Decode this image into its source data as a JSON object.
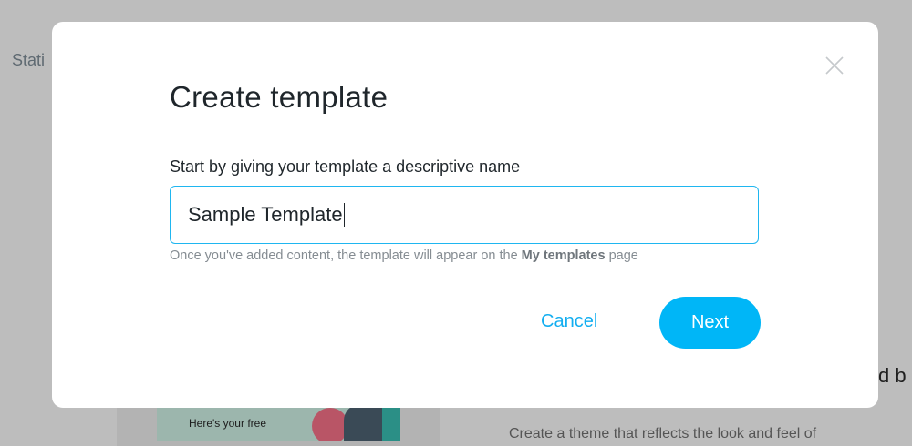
{
  "background": {
    "status_text": "Stati",
    "promo_text": "Here's your free",
    "heading_fragment": "d b",
    "body_fragment": "Create a theme that reflects the look and feel of"
  },
  "modal": {
    "title": "Create template",
    "field_label": "Start by giving your template a descriptive name",
    "input_value": "Sample Template",
    "hint_prefix": "Once you've added content, the template will appear on the ",
    "hint_link": "My templates",
    "hint_suffix": " page",
    "cancel_label": "Cancel",
    "next_label": "Next",
    "close_icon": "close-icon"
  },
  "colors": {
    "accent": "#00b6f7",
    "overlay": "#bdbdbd"
  }
}
